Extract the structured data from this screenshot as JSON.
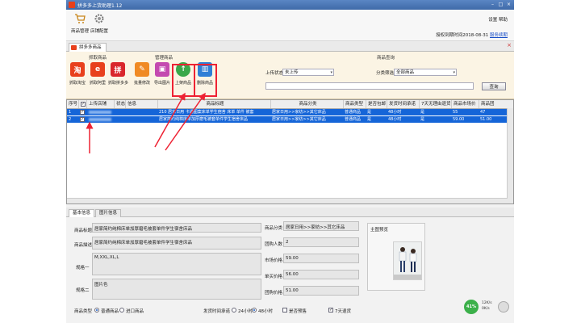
{
  "window": {
    "title": "拼多多上货助理1.12"
  },
  "toolbar": {
    "buttons": [
      {
        "label": "商品管理",
        "icon": "cart-icon"
      },
      {
        "label": "店铺配置",
        "icon": "gear-icon"
      }
    ],
    "right_top": "设置 帮助",
    "right_link_text": "授权到期时间2018-08-31",
    "right_link": "服务续期"
  },
  "tab": {
    "label": "拼多多商品"
  },
  "ops": {
    "group_collect": "抓取商品",
    "group_manage": "管理商品",
    "group_query": "商品查询",
    "collect_buttons": [
      {
        "label": "抓取淘宝",
        "glyph": "淘",
        "color": "#e8401c"
      },
      {
        "label": "抓取阿里",
        "glyph": "e",
        "color": "#e8401c"
      },
      {
        "label": "抓取拼多多",
        "glyph": "拼",
        "color": "#d9262c"
      }
    ],
    "manage_buttons": [
      {
        "label": "批量修改",
        "glyph": "✎",
        "color": "#f08a24"
      },
      {
        "label": "导出图片",
        "glyph": "▣",
        "color": "#c44ab0"
      },
      {
        "label": "上架商品",
        "glyph": "↑",
        "color": "#3aa84a"
      },
      {
        "label": "删除商品",
        "glyph": "▥",
        "color": "#2f7fd6"
      }
    ],
    "status_label": "上传状态",
    "status_value": "未上传",
    "filter_label": "分类筛选",
    "filter_value": "全部商品",
    "search_placeholder": "",
    "search_button": "查询"
  },
  "grid": {
    "columns": [
      "序号",
      "",
      "上传店铺",
      "状态",
      "信息",
      "商品标题",
      "商品分类",
      "商品类型",
      "是否包邮",
      "发货时间承诺",
      "7天无理由退货",
      "商品市场价",
      "商品团"
    ],
    "rows": [
      {
        "no": "1",
        "checked": true,
        "shop": "",
        "status": "",
        "info": "",
        "title": "210 居家日用 卡通图案床单学生宿舍 床单 单件 被套",
        "category": "居家日用>>家纺>>其它床品",
        "type": "普通商品",
        "free_ship": "是",
        "ship_time": "48小时",
        "seven_day": "是",
        "market": "55",
        "group": "47"
      },
      {
        "no": "2",
        "checked": true,
        "shop": "",
        "status": "",
        "info": "",
        "title": "居家简约纯棉床单加厚磨毛被套单件学生宿舍床品",
        "category": "居家日用>>家纺>>其它床品",
        "type": "普通商品",
        "free_ship": "是",
        "ship_time": "48小时",
        "seven_day": "是",
        "market": "59.00",
        "group": "51.00"
      }
    ]
  },
  "detail_tabs": [
    "基本信息",
    "图片信息"
  ],
  "detail": {
    "title_label": "商品标题",
    "title_value": "居家简约纯棉床单加厚磨毛被套单件学生宿舍床品",
    "desc_label": "商品描述",
    "desc_value": "居家简约纯棉床单加厚磨毛被套单件学生宿舍床品",
    "spec1_label": "规格一",
    "spec1_value": "M,XXL,XL,L",
    "spec2_label": "规格二",
    "spec2_value": "图片色",
    "category_label": "商品分类",
    "category_value": "居家日用>>家纺>>其它床品",
    "group_people_label": "团购人数",
    "group_people_value": "2",
    "market_label": "市场价格",
    "market_value": "59.00",
    "single_label": "单买价格",
    "single_value": "56.00",
    "group_price_label": "团购价格",
    "group_price_value": "51.00",
    "main_image_label": "主图预览",
    "type_label": "商品类型",
    "type_opt1": "普通商品",
    "type_opt2": "进口商品",
    "ship_label": "发货时间承诺",
    "ship_opt1": "24小时",
    "ship_opt2": "48小时",
    "presale": "是否预售",
    "seven_day": "7天退货",
    "gauge": "41%",
    "net_up": "12K/s",
    "net_down": "0K/s"
  }
}
